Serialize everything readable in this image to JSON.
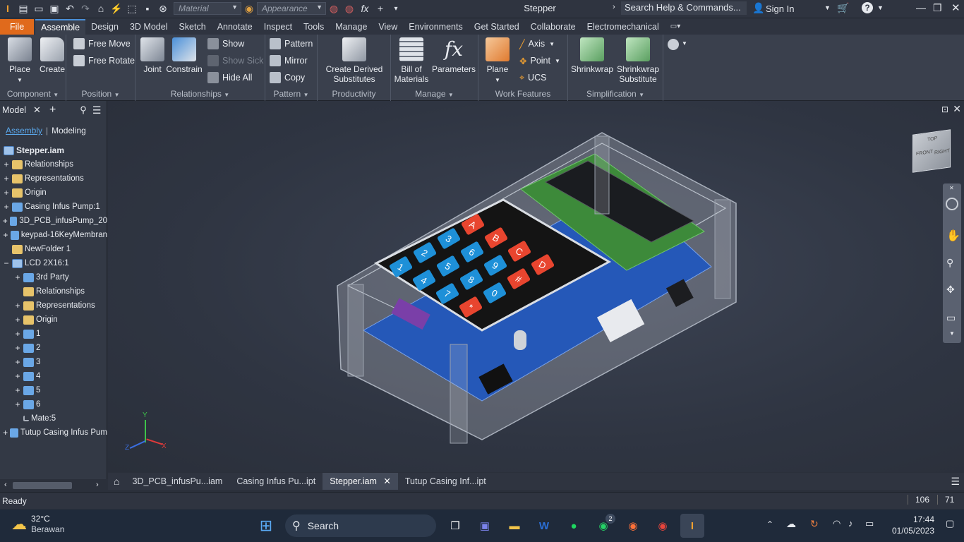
{
  "app": {
    "title": "Stepper",
    "search_placeholder": "Search Help & Commands...",
    "sign_in": "Sign In"
  },
  "quick_access": {
    "material": "Material",
    "appearance": "Appearance"
  },
  "menu": [
    "File",
    "Assemble",
    "Design",
    "3D Model",
    "Sketch",
    "Annotate",
    "Inspect",
    "Tools",
    "Manage",
    "View",
    "Environments",
    "Get Started",
    "Collaborate",
    "Electromechanical"
  ],
  "ribbon": {
    "component": {
      "label": "Component",
      "place": "Place",
      "create": "Create"
    },
    "position": {
      "label": "Position",
      "free_move": "Free Move",
      "free_rotate": "Free Rotate"
    },
    "relationships": {
      "label": "Relationships",
      "joint": "Joint",
      "constrain": "Constrain",
      "show": "Show",
      "show_sick": "Show Sick",
      "hide_all": "Hide All"
    },
    "pattern": {
      "label": "Pattern",
      "pattern": "Pattern",
      "mirror": "Mirror",
      "copy": "Copy"
    },
    "productivity": {
      "label": "Productivity",
      "create_derived_1": "Create Derived",
      "create_derived_2": "Substitutes"
    },
    "manage": {
      "label": "Manage",
      "bom_1": "Bill of",
      "bom_2": "Materials",
      "parameters": "Parameters"
    },
    "work_features": {
      "label": "Work Features",
      "plane": "Plane",
      "axis": "Axis",
      "point": "Point",
      "ucs": "UCS"
    },
    "simplification": {
      "label": "Simplification",
      "shrinkwrap": "Shrinkwrap",
      "shrinkwrap_sub_1": "Shrinkwrap",
      "shrinkwrap_sub_2": "Substitute"
    }
  },
  "browser": {
    "title": "Model",
    "tab_assembly": "Assembly",
    "tab_modeling": "Modeling",
    "root": "Stepper.iam",
    "nodes": [
      {
        "label": "Relationships",
        "icon": "folder"
      },
      {
        "label": "Representations",
        "icon": "folder"
      },
      {
        "label": "Origin",
        "icon": "folder"
      },
      {
        "label": "Casing Infus Pump:1",
        "icon": "part"
      },
      {
        "label": "3D_PCB_infusPump_20",
        "icon": "part"
      },
      {
        "label": "keypad-16KeyMembran",
        "icon": "part"
      },
      {
        "label": "NewFolder 1",
        "icon": "folder"
      },
      {
        "label": "LCD 2X16:1",
        "icon": "asm"
      },
      {
        "label": "3rd Party",
        "icon": "part"
      },
      {
        "label": "Relationships",
        "icon": "folder"
      },
      {
        "label": "Representations",
        "icon": "folder"
      },
      {
        "label": "Origin",
        "icon": "folder"
      },
      {
        "label": "1",
        "icon": "part"
      },
      {
        "label": "2",
        "icon": "part"
      },
      {
        "label": "3",
        "icon": "part"
      },
      {
        "label": "4",
        "icon": "part"
      },
      {
        "label": "5",
        "icon": "part"
      },
      {
        "label": "6",
        "icon": "part"
      },
      {
        "label": "Mate:5",
        "icon": "mate"
      },
      {
        "label": "Tutup Casing Infus Pum",
        "icon": "part"
      }
    ]
  },
  "keypad": [
    "1",
    "2",
    "3",
    "A",
    "4",
    "5",
    "6",
    "B",
    "7",
    "8",
    "9",
    "C",
    "*",
    "0",
    "#",
    "D"
  ],
  "viewcube": {
    "front": "FRONT",
    "right": "RIGHT",
    "top": "TOP"
  },
  "triad": {
    "x": "X",
    "y": "Y",
    "z": "Z"
  },
  "doc_tabs": [
    "3D_PCB_infusPu...iam",
    "Casing Infus Pu...ipt",
    "Stepper.iam",
    "Tutup Casing Inf...ipt"
  ],
  "status": {
    "text": "Ready",
    "count1": "106",
    "count2": "71"
  },
  "taskbar": {
    "weather_temp": "32°C",
    "weather_desc": "Berawan",
    "search": "Search",
    "whatsapp_badge": "2",
    "time": "17:44",
    "date": "01/05/2023"
  },
  "colors": {
    "accent": "#e06a1c",
    "key_blue": "#1e90d8",
    "key_red": "#e8452f",
    "pcb": "#2558b8"
  }
}
